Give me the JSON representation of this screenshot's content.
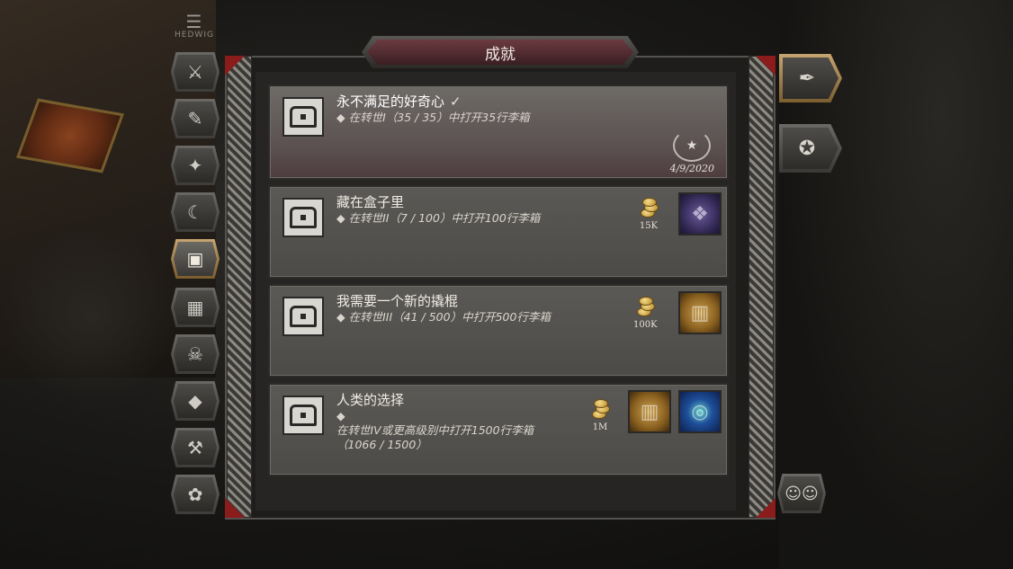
{
  "header": {
    "logo_text": "HEDWIG",
    "title": "成就"
  },
  "nav": {
    "items": [
      {
        "name": "nav-sword-icon",
        "glyph": "⚔"
      },
      {
        "name": "nav-scroll-icon",
        "glyph": "✎"
      },
      {
        "name": "nav-wings-icon",
        "glyph": "✦"
      },
      {
        "name": "nav-horn-icon",
        "glyph": "☾"
      },
      {
        "name": "nav-chest-icon",
        "glyph": "▣"
      },
      {
        "name": "nav-blocks-icon",
        "glyph": "▦"
      },
      {
        "name": "nav-demon-icon",
        "glyph": "☠"
      },
      {
        "name": "nav-gem-icon",
        "glyph": "◆"
      },
      {
        "name": "nav-hammer-icon",
        "glyph": "⚒"
      },
      {
        "name": "nav-pet-icon",
        "glyph": "✿"
      }
    ],
    "active_index": 4
  },
  "achievements": [
    {
      "title": "永不满足的好奇心",
      "completed": true,
      "check": "✓",
      "desc": "◆ 在转世I（35 / 35）中打开35行李箱",
      "date": "4/9/2020"
    },
    {
      "title": "藏在盒子里",
      "completed": false,
      "desc": "◆ 在转世II（7 / 100）中打开100行李箱",
      "gold": "15K",
      "items": [
        "cube"
      ]
    },
    {
      "title": "我需要一个新的撬棍",
      "completed": false,
      "desc": "◆ 在转世III（41 / 500）中打开500行李箱",
      "gold": "100K",
      "items": [
        "gold"
      ]
    },
    {
      "title": "人类的选择",
      "completed": false,
      "desc_bullet": "◆",
      "desc": "在转世IV或更高级别中打开1500行李箱（1066 / 1500）",
      "gold": "1M",
      "items": [
        "gold",
        "blue"
      ]
    }
  ],
  "right_tabs": [
    {
      "name": "feather-tab-icon",
      "glyph": "✒",
      "active": true
    },
    {
      "name": "laurel-star-tab-icon",
      "glyph": "✪",
      "active": false
    }
  ],
  "social_icon": "☺☺"
}
